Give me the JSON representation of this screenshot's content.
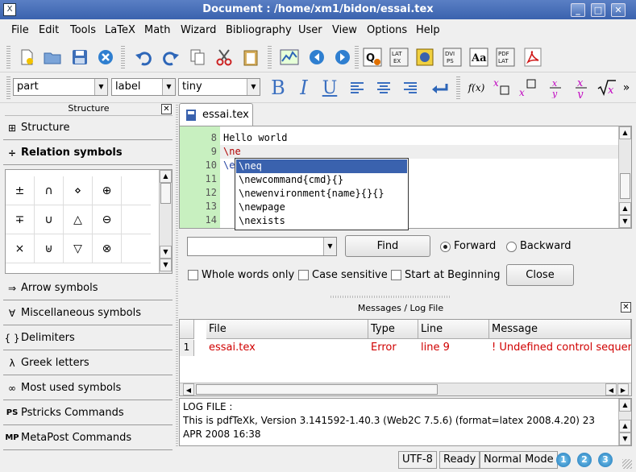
{
  "window": {
    "title": "Document : /home/xm1/bidon/essai.tex",
    "app_icon": "X"
  },
  "menu": [
    "File",
    "Edit",
    "Tools",
    "LaTeX",
    "Math",
    "Wizard",
    "Bibliography",
    "User",
    "View",
    "Options",
    "Help"
  ],
  "toolbar2": {
    "sectioning": "part",
    "label": "label",
    "size": "tiny",
    "bold": "B",
    "italic": "I",
    "underline": "U",
    "fx": "f(x)",
    "more": "»"
  },
  "structure_panel": {
    "title": "Structure",
    "sections": [
      {
        "icon": "⊞",
        "label": "Structure"
      },
      {
        "icon": "÷",
        "label": "Relation symbols"
      },
      {
        "icon": "⇒",
        "label": "Arrow symbols"
      },
      {
        "icon": "∀",
        "label": "Miscellaneous symbols"
      },
      {
        "icon": "{ }",
        "label": "Delimiters"
      },
      {
        "icon": "λ",
        "label": "Greek letters"
      },
      {
        "icon": "∞",
        "label": "Most used symbols"
      },
      {
        "icon": "PS",
        "label": "Pstricks Commands"
      },
      {
        "icon": "MP",
        "label": "MetaPost Commands"
      }
    ],
    "symbols": [
      [
        "±",
        "∩",
        "⋄",
        "⊕"
      ],
      [
        "∓",
        "∪",
        "△",
        "⊖"
      ],
      [
        "×",
        "⊎",
        "▽",
        "⊗"
      ]
    ]
  },
  "editor": {
    "tab_label": "essai.tex",
    "lines": [
      {
        "n": "8",
        "text": "Hello world"
      },
      {
        "n": "9",
        "text": "\\ne"
      },
      {
        "n": "10",
        "text": "\\e"
      },
      {
        "n": "11",
        "text": ""
      },
      {
        "n": "12",
        "text": ""
      },
      {
        "n": "13",
        "text": ""
      },
      {
        "n": "14",
        "text": ""
      }
    ],
    "completions": [
      "\\neq",
      "\\newcommand{cmd}{}",
      "\\newenvironment{name}{}{}",
      "\\newpage",
      "\\nexists"
    ]
  },
  "find": {
    "input_value": "",
    "find_label": "Find",
    "forward_label": "Forward",
    "backward_label": "Backward",
    "whole_words": "Whole words only",
    "case_sensitive": "Case sensitive",
    "start_begin": "Start at Beginning",
    "close_label": "Close"
  },
  "messages": {
    "title": "Messages / Log File",
    "columns": [
      "File",
      "Type",
      "Line",
      "Message"
    ],
    "rows": [
      {
        "num": "1",
        "file": "essai.tex",
        "type": "Error",
        "line": "line 9",
        "message": "! Undefined control sequenc"
      }
    ],
    "log_lines": [
      "LOG FILE :",
      "This is pdfTeXk, Version 3.141592-1.40.3 (Web2C 7.5.6) (format=latex 2008.4.20)  23",
      "APR 2008 16:38"
    ]
  },
  "status": {
    "encoding": "UTF-8",
    "state": "Ready",
    "mode": "Normal Mode",
    "views": [
      "1",
      "2",
      "3"
    ]
  },
  "colors": {
    "titlebar": "#3a62ae",
    "gutter": "#c8f0c0",
    "error": "#d00000",
    "latex_cmd": "#b00000"
  }
}
